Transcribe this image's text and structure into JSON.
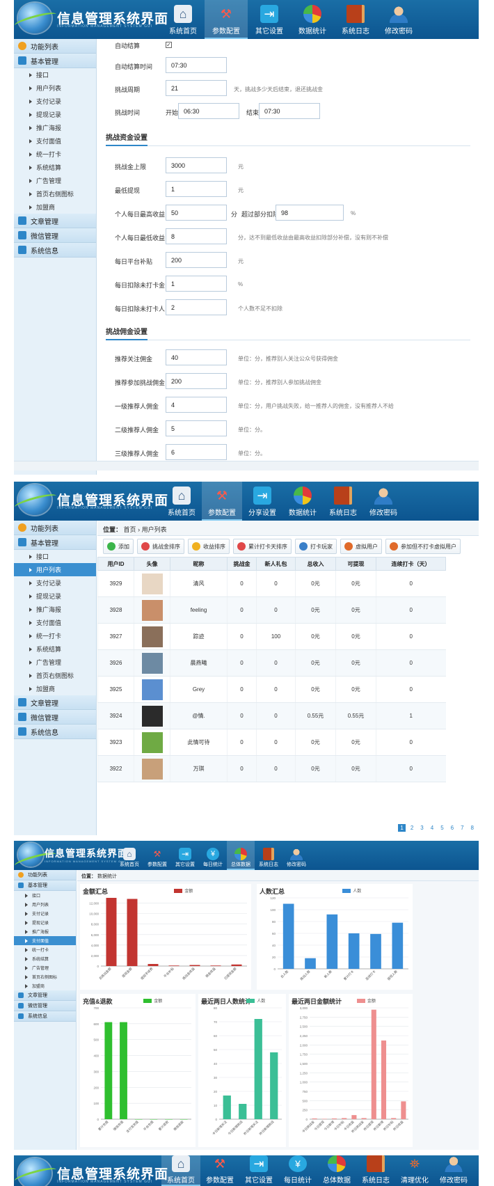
{
  "app": {
    "title": "信息管理系统界面",
    "subtitle": "INFORMATION MANAGEMENT SYSTEM GUI"
  },
  "screen1": {
    "nav": [
      "系统首页",
      "参数配置",
      "其它设置",
      "数据统计",
      "系统日志",
      "修改密码"
    ],
    "sidebar": {
      "head": "功能列表",
      "group": "基本管理",
      "items": [
        "接口",
        "用户列表",
        "支付记录",
        "提现记录",
        "推广海报",
        "支付面值",
        "统一打卡",
        "系统结算",
        "广告管理",
        "首页右侧图标",
        "加盟商"
      ],
      "others": [
        "文章管理",
        "微信管理",
        "系统信息"
      ]
    },
    "form": {
      "auto_settle": "自动结算",
      "auto_time_label": "自动结算时间",
      "auto_time": "07:30",
      "cycle_label": "挑战周期",
      "cycle": "21",
      "cycle_hint": "天，挑战多少天后结束，退还挑战金",
      "time_label": "挑战时间",
      "start_label": "开始",
      "start": "06:30",
      "end_label": "结束",
      "end": "07:30",
      "sec1": "挑战资金设置",
      "max_label": "挑战金上限",
      "max": "3000",
      "max_unit": "元",
      "min_w_label": "最低提现",
      "min_w": "1",
      "min_w_unit": "元",
      "day_max_label": "个人每日最高收益",
      "day_max": "50",
      "day_max_unit": "分",
      "over_label": "超过部分扣除",
      "over": "98",
      "over_unit": "%",
      "day_min_label": "个人每日最低收益",
      "day_min": "8",
      "day_min_hint": "分，达不到最低收益由最高收益扣除部分补偿，没有则不补偿",
      "sub_label": "每日平台补贴",
      "sub": "200",
      "sub_unit": "元",
      "ded_label": "每日扣除未打卡金",
      "ded": "1",
      "ded_unit": "%",
      "ded2_label": "每日扣除未打卡人",
      "ded2": "2",
      "ded2_hint": "个人数不足不扣除",
      "sec2": "挑战佣金设置",
      "c1_label": "推荐关注佣金",
      "c1": "40",
      "c1_hint": "单位：分，推荐别人关注公众号获得佣金",
      "c2_label": "推荐参加挑战佣金",
      "c2": "200",
      "c2_hint": "单位：分，推荐别人参加挑战佣金",
      "c3_label": "一级推荐人佣金",
      "c3": "4",
      "c3_hint": "单位：分，用户挑战失败，给一推荐人的佣金，没有推荐人不给",
      "c4_label": "二级推荐人佣金",
      "c4": "5",
      "c4_hint": "单位：分。",
      "c5_label": "三级推荐人佣金",
      "c5": "6",
      "c5_hint": "单位：分。"
    }
  },
  "screen2": {
    "nav": [
      "系统首页",
      "参数配置",
      "分享设置",
      "数据统计",
      "系统日志",
      "修改密码"
    ],
    "crumb": {
      "label": "位置：",
      "home": "首页",
      "sep": "›",
      "page": "用户列表"
    },
    "toolbar": [
      "添加",
      "挑战金排序",
      "收益排序",
      "累计打卡天排序",
      "打卡玩家",
      "虚拟用户",
      "参加但不打卡虚拟用户"
    ],
    "columns": [
      "用户ID",
      "头像",
      "昵称",
      "挑战金",
      "新人礼包",
      "总收入",
      "可提现",
      "连续打卡（天）"
    ],
    "rows": [
      [
        "3929",
        "",
        "清风",
        "0",
        "0",
        "0元",
        "0元",
        "0"
      ],
      [
        "3928",
        "",
        "feeling",
        "0",
        "0",
        "0元",
        "0元",
        "0"
      ],
      [
        "3927",
        "",
        "踪迹",
        "0",
        "100",
        "0元",
        "0元",
        "0"
      ],
      [
        "3926",
        "",
        "晨燕曦",
        "0",
        "0",
        "0元",
        "0元",
        "0"
      ],
      [
        "3925",
        "",
        "Grey",
        "0",
        "0",
        "0元",
        "0元",
        "0"
      ],
      [
        "3924",
        "",
        "@情.",
        "0",
        "0",
        "0.55元",
        "0.55元",
        "1"
      ],
      [
        "3923",
        "",
        "此情可待",
        "0",
        "0",
        "0元",
        "0元",
        "0"
      ],
      [
        "3922",
        "",
        "万琪",
        "0",
        "0",
        "0元",
        "0元",
        "0"
      ]
    ],
    "avatar_colors": [
      "#e8d7c4",
      "#c98f6a",
      "#8a6f5a",
      "#6d8aa3",
      "#5b8fd0",
      "#2b2b2b",
      "#6faa44",
      "#c8a07a"
    ],
    "pages": [
      "1",
      "2",
      "3",
      "4",
      "5",
      "6",
      "7",
      "8"
    ]
  },
  "screen3": {
    "nav": [
      "系统首页",
      "参数配置",
      "其它设置",
      "每日统计",
      "总体数据",
      "系统日志",
      "修改密码"
    ],
    "crumb": {
      "label": "位置：",
      "page": "数据统计"
    },
    "sidebar_sel": "支付面值"
  },
  "screen4": {
    "nav": [
      "系统首页",
      "参数配置",
      "其它设置",
      "每日统计",
      "总体数据",
      "系统日志",
      "清理优化",
      "修改密码"
    ]
  },
  "chart_data": [
    {
      "type": "bar",
      "title": "金额汇总",
      "series": [
        {
          "name": "金额",
          "values": [
            13200,
            12800,
            400,
            100,
            200,
            100,
            300
          ]
        }
      ],
      "categories": [
        "总挑战金额",
        "提现金额",
        "提现手续费",
        "平台补贴",
        "挑战金收益",
        "佣金收益",
        "已提现金额"
      ],
      "ylim": [
        0,
        13000
      ],
      "yticks": [
        0,
        2000,
        4000,
        6000,
        8000,
        10000,
        12000
      ],
      "color": "#c23531"
    },
    {
      "type": "bar",
      "title": "人数汇总",
      "series": [
        {
          "name": "人数",
          "values": [
            110,
            18,
            92,
            60,
            59,
            78
          ]
        }
      ],
      "categories": [
        "总人数",
        "挑战人数",
        "新人数",
        "累计打卡",
        "连续打卡",
        "提现人数"
      ],
      "ylim": [
        0,
        120
      ],
      "yticks": [
        0,
        20,
        40,
        60,
        80,
        100,
        120
      ],
      "color": "#3a8ed8"
    },
    {
      "type": "bar",
      "title": "充值&退款",
      "series": [
        {
          "name": "金额",
          "values": [
            610,
            610,
            0,
            0,
            0,
            0
          ]
        }
      ],
      "categories": [
        "累计充值",
        "微信充值",
        "支付宝充值",
        "平台充值",
        "累计退款",
        "微信退款"
      ],
      "ylim": [
        0,
        700
      ],
      "yticks": [
        0,
        100,
        200,
        300,
        400,
        500,
        600,
        700
      ],
      "color": "#2fbf2f"
    },
    {
      "type": "bar",
      "title": "最近两日人数统计",
      "series": [
        {
          "name": "人数",
          "values": [
            17,
            11,
            72,
            48
          ]
        }
      ],
      "categories": [
        "今日新增关注",
        "今日新增挑战",
        "昨日新增关注",
        "昨日新增挑战"
      ],
      "ylim": [
        0,
        80
      ],
      "yticks": [
        0,
        10,
        20,
        30,
        40,
        50,
        60,
        70,
        80
      ],
      "color": "#3bbf96"
    },
    {
      "type": "bar",
      "title": "最近两日金额统计",
      "series": [
        {
          "name": "金额",
          "values": [
            20,
            10,
            20,
            30,
            110,
            30,
            2950,
            2120,
            30,
            480
          ]
        }
      ],
      "categories": [
        "今日挑战金",
        "今日提现",
        "今日新增",
        "今日补贴",
        "今日收益",
        "昨日挑战金",
        "昨日提现",
        "昨日新增",
        "昨日补贴",
        "昨日收益"
      ],
      "ylim": [
        0,
        3000
      ],
      "yticks": [
        0,
        250,
        500,
        750,
        1000,
        1250,
        1500,
        1750,
        2000,
        2250,
        2500,
        2750,
        3000
      ],
      "color": "#ee8f8f"
    }
  ]
}
